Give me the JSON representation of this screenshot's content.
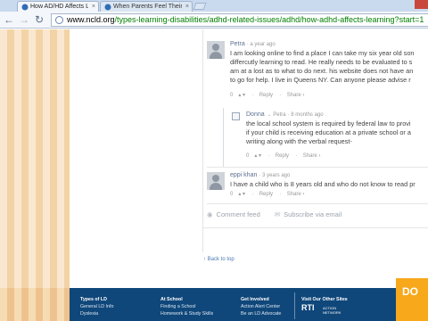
{
  "browser": {
    "tabs": [
      {
        "title": "How AD/HD Affects Lea"
      },
      {
        "title": "When Parents Feel Their"
      }
    ],
    "url_prefix": "www.",
    "url_host": "ncld.org",
    "url_path": "/types-learning-disabilities/adhd-related-issues/adhd/how-adhd-affects-learning?start=1"
  },
  "comments": [
    {
      "author": "Petra",
      "time": "a year ago",
      "lines": [
        "I am looking online to find a place I can take my six year old son",
        "differcutly learning to read. He really needs to be evaluated to s",
        "am at a lost as to what to do next. his website does not have an",
        "to go for help. I live in Queens NY. Can anyone please advise r"
      ],
      "votes": "0",
      "reply": "Reply",
      "share": "Share ›"
    },
    {
      "author": "Donna",
      "reply_to": "→ Petra",
      "time": "8 months ago",
      "lines": [
        "the local school system is required by federal law to provi",
        "if your child is receiving education at a private school or a",
        "writing along with the verbal request-"
      ],
      "votes": "0",
      "reply": "Reply",
      "share": "Share ›"
    },
    {
      "author": "eppi khan",
      "time": "3 years ago",
      "lines": [
        "I have a child who is 8 years old and who do not know to read pr"
      ],
      "votes": "0",
      "reply": "Reply",
      "share": "Share ›"
    }
  ],
  "comment_links": {
    "feed": "Comment feed",
    "subscribe": "Subscribe via email"
  },
  "back_to_top": "↑ Back to top",
  "footer": {
    "col1": [
      "Types of LD",
      "General LD Info",
      "Dyslexia"
    ],
    "col2": [
      "At School",
      "Finding a School",
      "Homework & Study Skills"
    ],
    "col3": [
      "Get Involved",
      "Action Alert Center",
      "Be an LD Advocate"
    ],
    "col4_title": "Visit Our Other Sites",
    "rti_word": "RTI",
    "rti_sub1": "ACTION",
    "rti_sub2": "NETWORK",
    "orange_text": "DO"
  }
}
